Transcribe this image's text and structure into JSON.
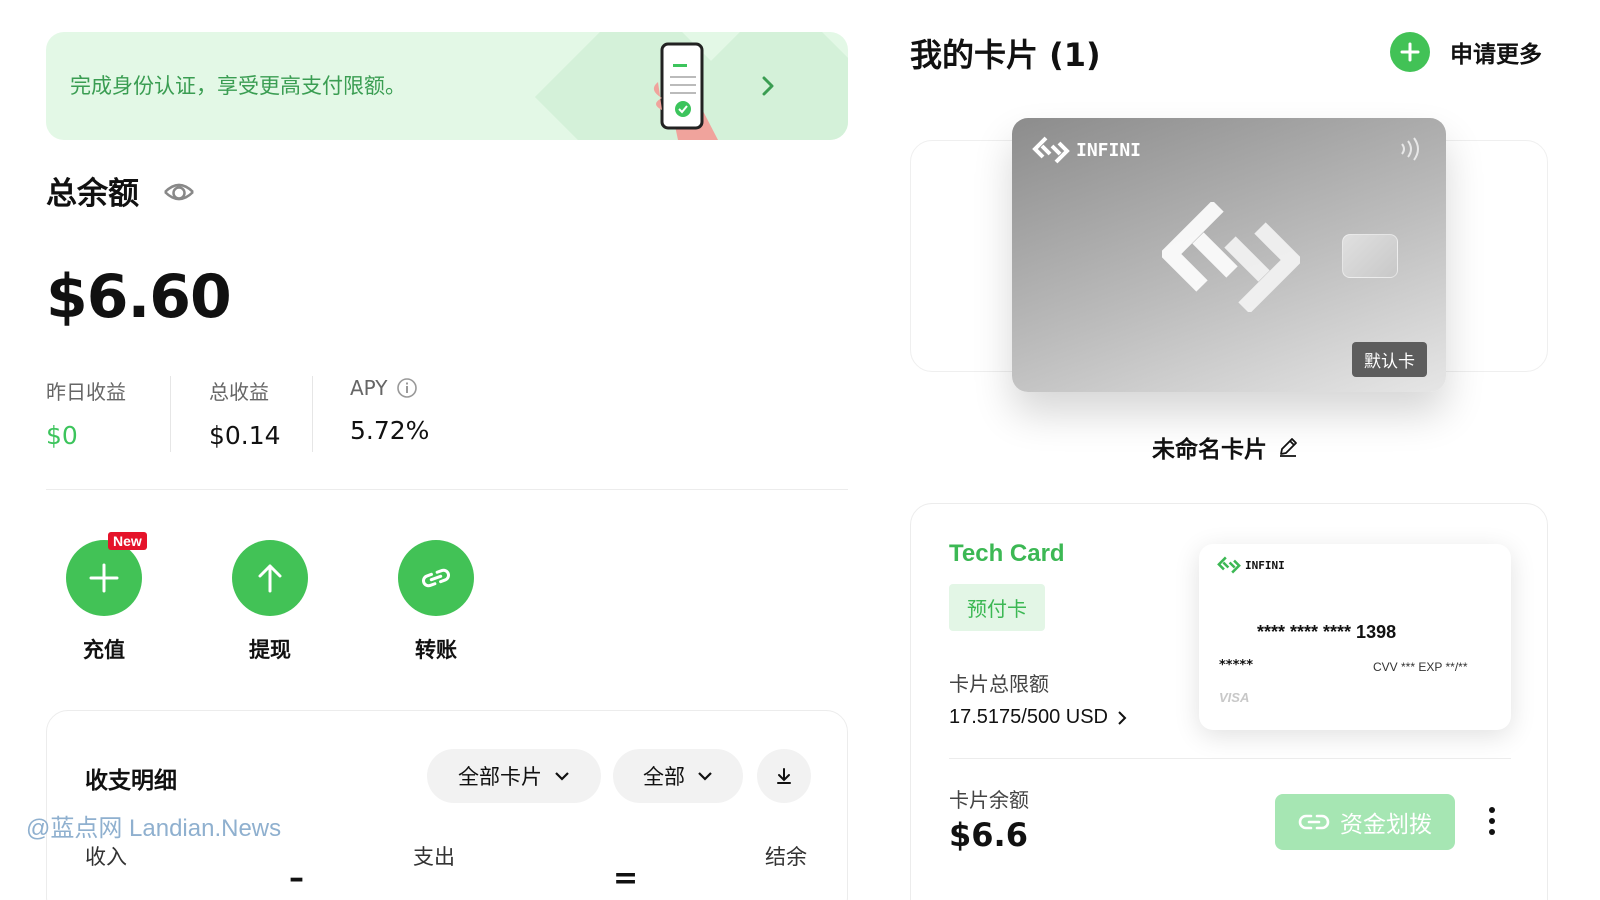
{
  "banner": {
    "text": "完成身份认证，享受更高支付限额。"
  },
  "balance": {
    "title": "总余额",
    "amount": "$6.60",
    "stats": [
      {
        "label": "昨日收益",
        "value": "$0",
        "color": "#3cc45c"
      },
      {
        "label": "总收益",
        "value": "$0.14"
      },
      {
        "label": "APY",
        "value": "5.72%"
      }
    ]
  },
  "actions": [
    {
      "label": "充值",
      "icon": "plus-icon",
      "badge": "New"
    },
    {
      "label": "提现",
      "icon": "arrow-up-icon"
    },
    {
      "label": "转账",
      "icon": "link-icon"
    }
  ],
  "transactions": {
    "title": "收支明细",
    "filter_cards": "全部卡片",
    "filter_type": "全部",
    "columns": [
      "收入",
      "支出",
      "结余"
    ]
  },
  "watermark": "@蓝点网 Landian.News",
  "cards": {
    "title": "我的卡片 (1)",
    "apply_more": "申请更多",
    "card_brand": "INFINI",
    "default_badge": "默认卡",
    "card_name": "未命名卡片"
  },
  "tech_card": {
    "name": "Tech Card",
    "type_badge": "预付卡",
    "limit_label": "卡片总限额",
    "limit_value": "17.5175/500 USD",
    "mini_brand": "INFINI",
    "number": "**** **** **** 1398",
    "holder": "*****",
    "cvv_exp": "CVV ***  EXP **/**",
    "network": "VISA",
    "balance_label": "卡片余额",
    "balance_value": "$6.6",
    "transfer_label": "资金划拨"
  },
  "colors": {
    "accent": "#42c256",
    "accent_text": "#3cc45c",
    "banner_bg": "#e3f8e6",
    "new_badge": "#e5132a",
    "transfer_disabled": "#a6e6b3"
  }
}
